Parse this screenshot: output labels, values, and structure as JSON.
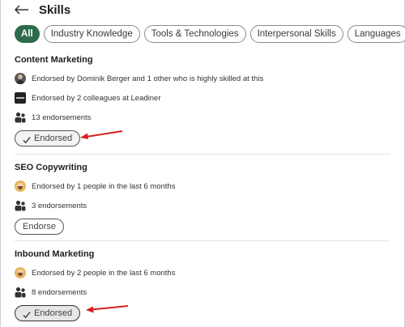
{
  "header": {
    "title": "Skills",
    "back_icon": "arrow-left-icon"
  },
  "filters": [
    {
      "label": "All",
      "active": true
    },
    {
      "label": "Industry Knowledge",
      "active": false
    },
    {
      "label": "Tools & Technologies",
      "active": false
    },
    {
      "label": "Interpersonal Skills",
      "active": false
    },
    {
      "label": "Languages",
      "active": false
    }
  ],
  "skills": [
    {
      "name": "Content Marketing",
      "endorsements": [
        {
          "avatar": "person-photo-avatar",
          "text": "Endorsed by Dominik Berger and 1 other who is highly skilled at this"
        },
        {
          "avatar": "company-logo-avatar",
          "text": "Endorsed by 2 colleagues at Leadiner"
        }
      ],
      "count_text": "13 endorsements",
      "button_label": "Endorsed",
      "button_state": "endorsed"
    },
    {
      "name": "SEO Copywriting",
      "endorsements": [
        {
          "avatar": "cartoon-avatar",
          "text": "Endorsed by 1 people in the last 6 months"
        }
      ],
      "count_text": "3 endorsements",
      "button_label": "Endorse",
      "button_state": "not-endorsed"
    },
    {
      "name": "Inbound Marketing",
      "endorsements": [
        {
          "avatar": "cartoon-avatar",
          "text": "Endorsed by 2 people in the last 6 months"
        }
      ],
      "count_text": "8 endorsements",
      "button_label": "Endorsed",
      "button_state": "endorsed"
    }
  ],
  "colors": {
    "accent": "#2e6b4c",
    "annotation_arrow": "#d42020"
  }
}
